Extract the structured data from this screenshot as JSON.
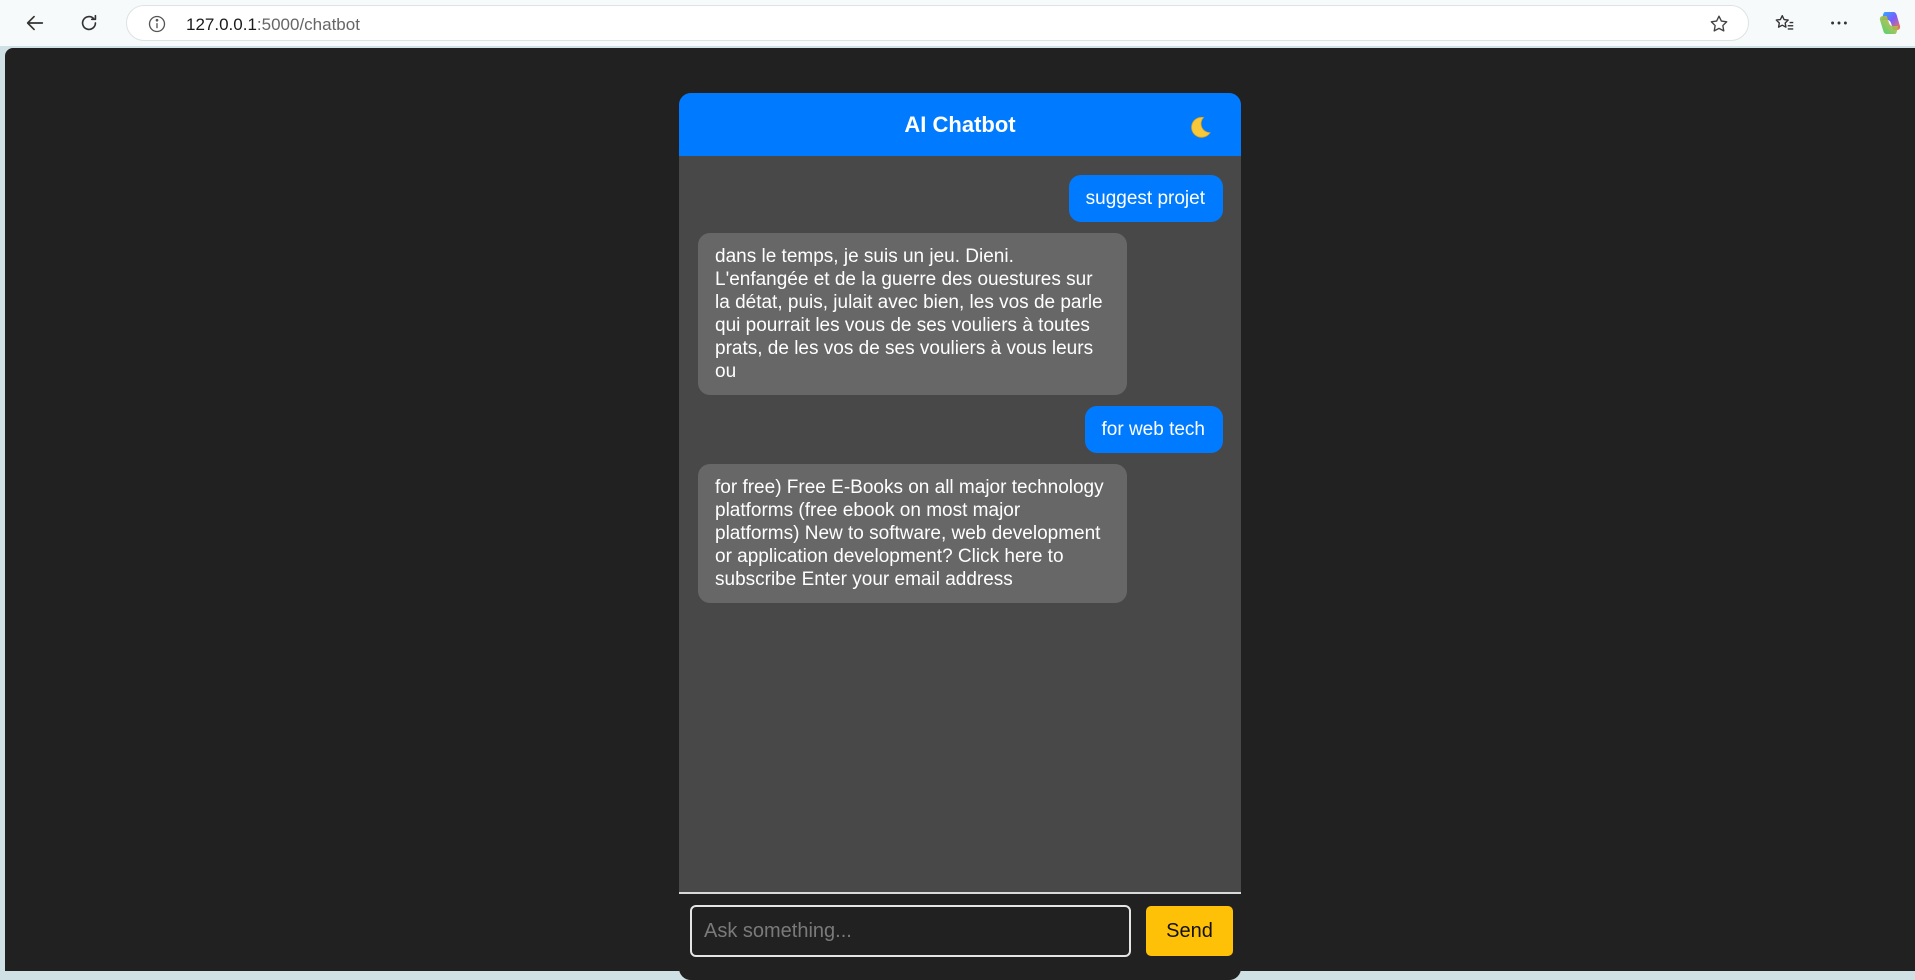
{
  "browser": {
    "url_host": "127.0.0.1",
    "url_rest": ":5000/chatbot"
  },
  "chat": {
    "title": "AI Chatbot",
    "theme_toggle_icon": "moon-icon",
    "messages": [
      {
        "role": "user",
        "text": "suggest projet"
      },
      {
        "role": "bot",
        "text": "dans le temps, je suis un jeu. Dieni. L'enfangée et de la guerre des ouestures sur la détat, puis, julait avec bien, les vos de parle qui pourrait les vous de ses vouliers à toutes prats, de les vos de ses vouliers à vous leurs ou"
      },
      {
        "role": "user",
        "text": "for web tech"
      },
      {
        "role": "bot",
        "text": "for free) Free E-Books on all major technology platforms (free ebook on most major platforms) New to software, web development or application development? Click here to subscribe Enter your email address"
      }
    ],
    "input": {
      "placeholder": "Ask something...",
      "value": ""
    },
    "send_label": "Send"
  },
  "colors": {
    "header": "#007bff",
    "user_bubble": "#007bff",
    "bot_bubble": "#676767",
    "send_button": "#ffc107",
    "page_bg": "#212121",
    "chat_bg": "#484848"
  }
}
